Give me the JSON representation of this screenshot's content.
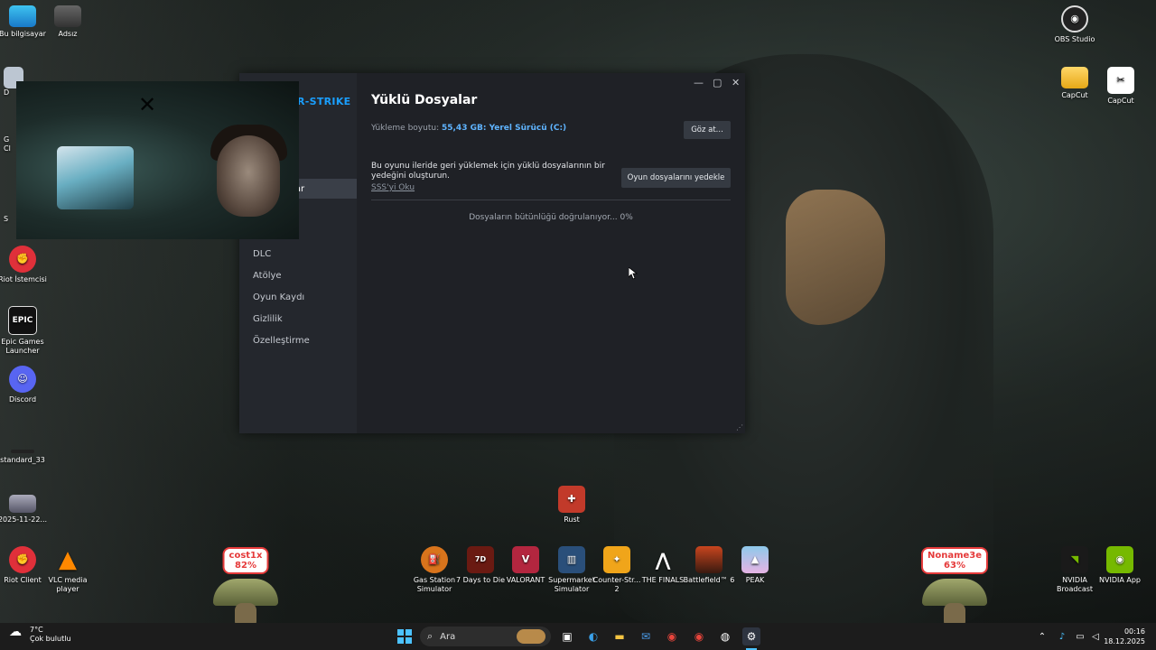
{
  "desktop": {
    "left_icons": [
      {
        "label": "Bu bilgisayar",
        "icon": "monitor-icon"
      },
      {
        "label": "Adsız",
        "icon": "photo-icon"
      },
      {
        "label": "Riot İstemcisi",
        "icon": "riot-icon"
      },
      {
        "label": "Epic Games Launcher",
        "icon": "epic-icon"
      },
      {
        "label": "Discord",
        "icon": "discord-icon"
      },
      {
        "label": "standard_33",
        "icon": "file-icon"
      },
      {
        "label": "2025-11-22...",
        "icon": "video-icon"
      },
      {
        "label": "Riot Client",
        "icon": "riot-icon"
      },
      {
        "label": "VLC media player",
        "icon": "vlc-icon"
      }
    ],
    "partial_labels": [
      "D",
      "G",
      "Cl",
      "S"
    ],
    "right_icons": [
      {
        "label": "OBS Studio",
        "icon": "obs-icon"
      },
      {
        "label": "CapCut",
        "icon": "folder-icon"
      },
      {
        "label": "CapCut",
        "icon": "capcut-icon"
      },
      {
        "label": "NVIDIA Broadcast",
        "icon": "nvidia-icon"
      },
      {
        "label": "NVIDIA App",
        "icon": "nvidia-icon"
      }
    ],
    "game_icons": [
      {
        "label": "Rust",
        "icon": "rust-icon"
      },
      {
        "label": "Gas Station Simulator",
        "icon": "game-icon"
      },
      {
        "label": "7 Days to Die",
        "icon": "game-icon"
      },
      {
        "label": "VALORANT",
        "icon": "valorant-icon"
      },
      {
        "label": "Supermarket Simulator",
        "icon": "game-icon"
      },
      {
        "label": "Counter-Str... 2",
        "icon": "cs-icon"
      },
      {
        "label": "THE FINALS",
        "icon": "game-icon"
      },
      {
        "label": "Battlefield™ 6",
        "icon": "game-icon"
      },
      {
        "label": "PEAK",
        "icon": "game-icon"
      }
    ],
    "badges": [
      {
        "name": "cost1x",
        "value": "82%"
      },
      {
        "name": "Noname3e",
        "value": "63%"
      }
    ]
  },
  "steam": {
    "game_title_partial": "R-STRIKE",
    "sidebar": {
      "items": [
        "ler",
        "alar",
        "DLC",
        "Atölye",
        "Oyun Kaydı",
        "Gizlilik",
        "Özelleştirme"
      ]
    },
    "page_title": "Yüklü Dosyalar",
    "size_label": "Yükleme boyutu:",
    "size_value": "55,43 GB: Yerel Sürücü (C:)",
    "browse_button": "Göz at...",
    "backup_desc": "Bu oyunu ileride geri yüklemek için yüklü dosyalarının bir yedeğini oluşturun.",
    "faq_link": "SSS'yi Oku",
    "backup_button": "Oyun dosyalarını yedekle",
    "verify_status": "Dosyaların bütünlüğü doğrulanıyor... 0%"
  },
  "taskbar": {
    "weather_temp": "7°C",
    "weather_desc": "Çok bulutlu",
    "search_placeholder": "Ara",
    "time": "00:16",
    "date": "18.12.2025"
  }
}
